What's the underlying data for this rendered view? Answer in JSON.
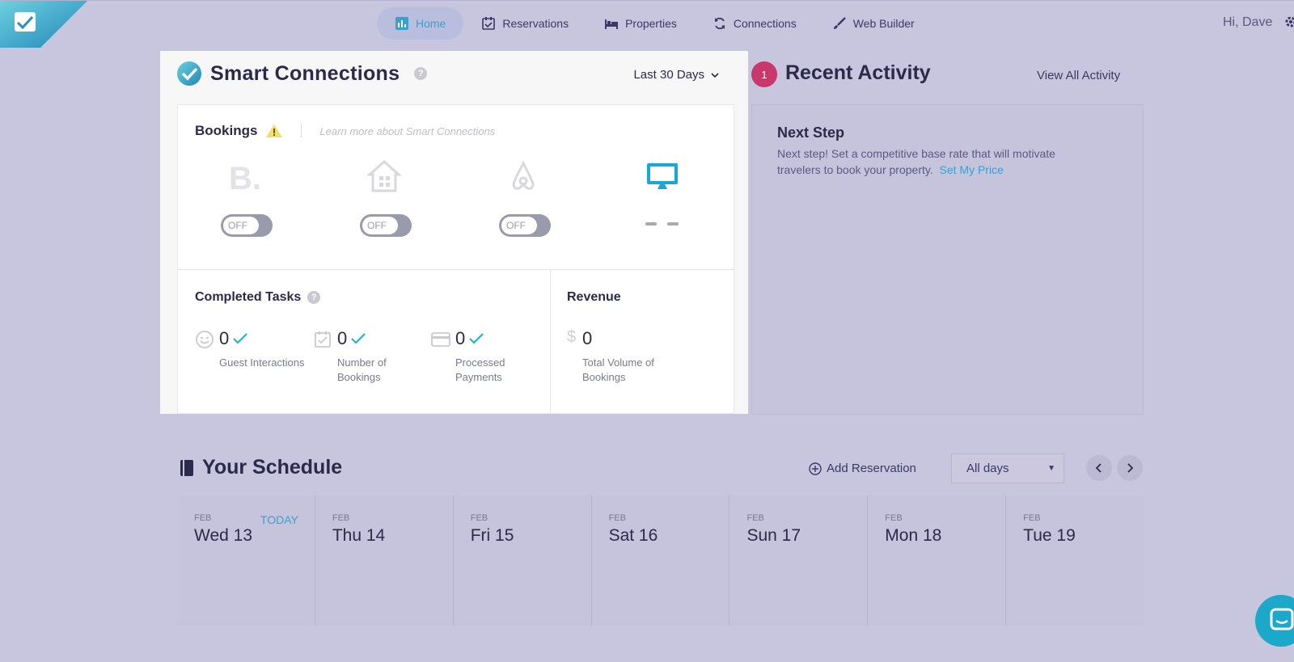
{
  "nav": {
    "items": [
      {
        "label": "Home",
        "icon": "bar-chart-icon",
        "active": true
      },
      {
        "label": "Reservations",
        "icon": "calendar-check-icon",
        "active": false
      },
      {
        "label": "Properties",
        "icon": "bed-icon",
        "active": false
      },
      {
        "label": "Connections",
        "icon": "sync-icon",
        "active": false
      },
      {
        "label": "Web Builder",
        "icon": "brush-icon",
        "active": false
      }
    ],
    "user_greeting": "Hi, Dave"
  },
  "smart": {
    "title": "Smart Connections",
    "range": "Last 30 Days",
    "bookings_title": "Bookings",
    "learn_more": "Learn more about Smart Connections",
    "toggle_off": "OFF",
    "completed_title": "Completed Tasks",
    "revenue_title": "Revenue",
    "stats": [
      {
        "value": "0",
        "label": "Guest Interactions"
      },
      {
        "value": "0",
        "label": "Number of Bookings"
      },
      {
        "value": "0",
        "label": "Processed Payments"
      }
    ],
    "revenue": {
      "currency": "$",
      "value": "0",
      "label": "Total Volume of Bookings"
    }
  },
  "activity": {
    "badge": "1",
    "title": "Recent Activity",
    "view_all": "View All Activity",
    "next_title": "Next Step",
    "next_text": "Next step! Set a competitive base rate that will motivate travelers to book your property.",
    "next_link": "Set My Price"
  },
  "schedule": {
    "title": "Your Schedule",
    "add_reservation": "Add Reservation",
    "filter": "All days",
    "today_label": "TODAY",
    "days": [
      {
        "month": "FEB",
        "day": "Wed 13"
      },
      {
        "month": "FEB",
        "day": "Thu 14"
      },
      {
        "month": "FEB",
        "day": "Fri 15"
      },
      {
        "month": "FEB",
        "day": "Sat 16"
      },
      {
        "month": "FEB",
        "day": "Sun 17"
      },
      {
        "month": "FEB",
        "day": "Mon 18"
      },
      {
        "month": "FEB",
        "day": "Tue 19"
      }
    ]
  },
  "colors": {
    "accent": "#3aa0cc",
    "badge": "#c8386b",
    "background": "#c8c5de"
  }
}
